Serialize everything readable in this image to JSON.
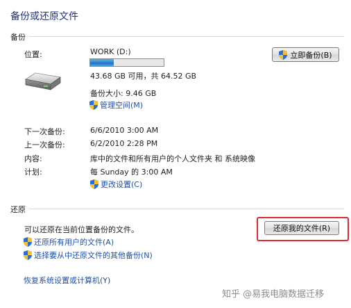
{
  "window": {
    "title": "备份或还原文件"
  },
  "backup": {
    "section_label": "备份",
    "location_label": "位置:",
    "drive_name": "WORK (D:)",
    "drive_usage_fraction": 0.3232,
    "space_text": "43.68 GB 可用，共 64.52 GB",
    "backup_size": "备份大小: 9.46 GB",
    "manage_space_link": "管理空间(M)",
    "backup_now_button": "立即备份(B)",
    "next_backup_label": "下一次备份:",
    "next_backup_value": "6/6/2010 3:00 AM",
    "last_backup_label": "上一次备份:",
    "last_backup_value": "6/2/2010 2:28 PM",
    "contents_label": "内容:",
    "contents_value": "库中的文件和所有用户的个人文件夹 和 系统映像",
    "schedule_label": "计划:",
    "schedule_value": "每 Sunday 的 3:00 AM",
    "change_settings_link": "更改设置(C)"
  },
  "restore": {
    "section_label": "还原",
    "description": "可以还原在当前位置备份的文件。",
    "restore_my_files_button": "还原我的文件(R)",
    "restore_all_users_link": "还原所有用户的文件(A)",
    "select_other_backup_link": "选择要从中还原文件的其他备份(N)",
    "recover_system_link": "恢复系统设置或计算机(Y)"
  },
  "watermark": "知乎 @易我电脑数据迁移",
  "colors": {
    "title": "#1e3287",
    "link": "#1f4fa8",
    "progress": "#2a86d1",
    "highlight": "#e0282f"
  }
}
